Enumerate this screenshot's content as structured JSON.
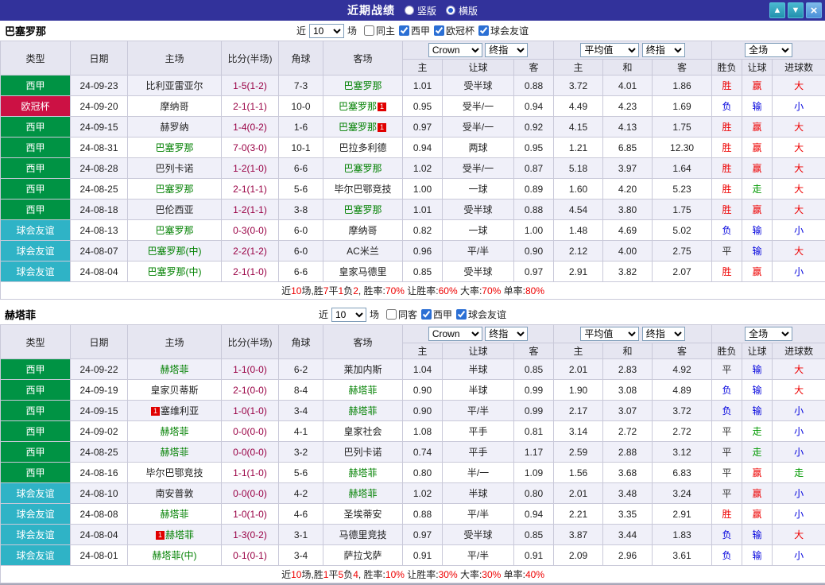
{
  "titlebar": {
    "title": "近期战绩",
    "layout_options": [
      {
        "label": "竖版",
        "selected": false
      },
      {
        "label": "横版",
        "selected": true
      }
    ],
    "buttons": {
      "up": "▲",
      "down": "▼",
      "close": "×"
    }
  },
  "filter_common": {
    "near": "近",
    "games": "场"
  },
  "table": {
    "columns": [
      "类型",
      "日期",
      "主场",
      "比分(半场)",
      "角球",
      "客场"
    ],
    "odds_group": {
      "company": "Crown",
      "stage": "终指"
    },
    "euro_group": {
      "avg": "平均值",
      "stage": "终指"
    },
    "period": "全场",
    "subcolumns": [
      "主",
      "让球",
      "客",
      "主",
      "和",
      "客",
      "胜负",
      "让球",
      "进球数"
    ]
  },
  "colors": {
    "c-titlebar": "#32329b",
    "c-liga": "#009344",
    "c-ucl": "#cc1144",
    "c-friendly": "#2fb3c6",
    "c-win": "#ee0000",
    "c-lose": "#0000dd",
    "c-draw": "#333333",
    "c-walk": "#009900",
    "c-score": "#990044",
    "c-focal": "#008000",
    "c-headbg": "#e6e6f1",
    "c-rowalt": "#f0f0f9",
    "c-border": "#c9c9d9"
  },
  "sections": [
    {
      "team": "巴塞罗那",
      "recent_count": "10",
      "checkboxes": [
        {
          "label": "同主",
          "checked": false
        },
        {
          "label": "西甲",
          "checked": true
        },
        {
          "label": "欧冠杯",
          "checked": true
        },
        {
          "label": "球会友谊",
          "checked": true
        }
      ],
      "rows": [
        {
          "type": "西甲",
          "type_cls": "liga",
          "date": "24-09-23",
          "home": "比利亚雷亚尔",
          "score": "1-5(1-2)",
          "corner": "7-3",
          "away": "巴塞罗那",
          "odds_home": "1.01",
          "handicap": "受半球",
          "odds_away": "0.88",
          "avg_home": "3.72",
          "avg_draw": "4.01",
          "avg_away": "1.86",
          "result": "胜",
          "handicap_result": "赢",
          "goals": "大"
        },
        {
          "type": "欧冠杯",
          "type_cls": "ucl",
          "date": "24-09-20",
          "home": "摩纳哥",
          "score": "2-1(1-1)",
          "corner": "10-0",
          "away": "巴塞罗那",
          "away_badge": "1",
          "away_badge_pos": "post",
          "odds_home": "0.95",
          "handicap": "受半/一",
          "odds_away": "0.94",
          "avg_home": "4.49",
          "avg_draw": "4.23",
          "avg_away": "1.69",
          "result": "负",
          "handicap_result": "输",
          "goals": "小"
        },
        {
          "type": "西甲",
          "type_cls": "liga",
          "date": "24-09-15",
          "home": "赫罗纳",
          "score": "1-4(0-2)",
          "corner": "1-6",
          "away": "巴塞罗那",
          "away_badge": "1",
          "away_badge_pos": "post",
          "odds_home": "0.97",
          "handicap": "受半/一",
          "odds_away": "0.92",
          "avg_home": "4.15",
          "avg_draw": "4.13",
          "avg_away": "1.75",
          "result": "胜",
          "handicap_result": "赢",
          "goals": "大"
        },
        {
          "type": "西甲",
          "type_cls": "liga",
          "date": "24-08-31",
          "home": "巴塞罗那",
          "score": "7-0(3-0)",
          "corner": "10-1",
          "away": "巴拉多利德",
          "odds_home": "0.94",
          "handicap": "两球",
          "odds_away": "0.95",
          "avg_home": "1.21",
          "avg_draw": "6.85",
          "avg_away": "12.30",
          "result": "胜",
          "handicap_result": "赢",
          "goals": "大"
        },
        {
          "type": "西甲",
          "type_cls": "liga",
          "date": "24-08-28",
          "home": "巴列卡诺",
          "score": "1-2(1-0)",
          "corner": "6-6",
          "away": "巴塞罗那",
          "odds_home": "1.02",
          "handicap": "受半/一",
          "odds_away": "0.87",
          "avg_home": "5.18",
          "avg_draw": "3.97",
          "avg_away": "1.64",
          "result": "胜",
          "handicap_result": "赢",
          "goals": "大"
        },
        {
          "type": "西甲",
          "type_cls": "liga",
          "date": "24-08-25",
          "home": "巴塞罗那",
          "score": "2-1(1-1)",
          "corner": "5-6",
          "away": "毕尔巴鄂竞技",
          "odds_home": "1.00",
          "handicap": "一球",
          "odds_away": "0.89",
          "avg_home": "1.60",
          "avg_draw": "4.20",
          "avg_away": "5.23",
          "result": "胜",
          "handicap_result": "走",
          "goals": "大"
        },
        {
          "type": "西甲",
          "type_cls": "liga",
          "date": "24-08-18",
          "home": "巴伦西亚",
          "score": "1-2(1-1)",
          "corner": "3-8",
          "away": "巴塞罗那",
          "odds_home": "1.01",
          "handicap": "受半球",
          "odds_away": "0.88",
          "avg_home": "4.54",
          "avg_draw": "3.80",
          "avg_away": "1.75",
          "result": "胜",
          "handicap_result": "赢",
          "goals": "大"
        },
        {
          "type": "球会友谊",
          "type_cls": "friendly",
          "date": "24-08-13",
          "home": "巴塞罗那",
          "score": "0-3(0-0)",
          "corner": "6-0",
          "away": "摩纳哥",
          "odds_home": "0.82",
          "handicap": "一球",
          "odds_away": "1.00",
          "avg_home": "1.48",
          "avg_draw": "4.69",
          "avg_away": "5.02",
          "result": "负",
          "handicap_result": "输",
          "goals": "小"
        },
        {
          "type": "球会友谊",
          "type_cls": "friendly",
          "date": "24-08-07",
          "home": "巴塞罗那(中)",
          "score": "2-2(1-2)",
          "corner": "6-0",
          "away": "AC米兰",
          "odds_home": "0.96",
          "handicap": "平/半",
          "odds_away": "0.90",
          "avg_home": "2.12",
          "avg_draw": "4.00",
          "avg_away": "2.75",
          "result": "平",
          "handicap_result": "输",
          "goals": "大"
        },
        {
          "type": "球会友谊",
          "type_cls": "friendly",
          "date": "24-08-04",
          "home": "巴塞罗那(中)",
          "score": "2-1(1-0)",
          "corner": "6-6",
          "away": "皇家马德里",
          "odds_home": "0.85",
          "handicap": "受半球",
          "odds_away": "0.97",
          "avg_home": "2.91",
          "avg_draw": "3.82",
          "avg_away": "2.07",
          "result": "胜",
          "handicap_result": "赢",
          "goals": "小"
        }
      ],
      "summary": [
        [
          "近",
          0
        ],
        [
          "10",
          1
        ],
        [
          "场,胜",
          0
        ],
        [
          "7",
          1
        ],
        [
          "平",
          0
        ],
        [
          "1",
          1
        ],
        [
          "负",
          0
        ],
        [
          "2",
          1
        ],
        [
          ", 胜率:",
          0
        ],
        [
          "70%",
          1
        ],
        [
          " 让胜率:",
          0
        ],
        [
          "60%",
          1
        ],
        [
          " 大率:",
          0
        ],
        [
          "70%",
          1
        ],
        [
          " 单率:",
          0
        ],
        [
          "80%",
          1
        ]
      ]
    },
    {
      "team": "赫塔菲",
      "recent_count": "10",
      "checkboxes": [
        {
          "label": "同客",
          "checked": false
        },
        {
          "label": "西甲",
          "checked": true
        },
        {
          "label": "球会友谊",
          "checked": true
        }
      ],
      "rows": [
        {
          "type": "西甲",
          "type_cls": "liga",
          "date": "24-09-22",
          "home": "赫塔菲",
          "score": "1-1(0-0)",
          "corner": "6-2",
          "away": "莱加内斯",
          "odds_home": "1.04",
          "handicap": "半球",
          "odds_away": "0.85",
          "avg_home": "2.01",
          "avg_draw": "2.83",
          "avg_away": "4.92",
          "result": "平",
          "handicap_result": "输",
          "goals": "大"
        },
        {
          "type": "西甲",
          "type_cls": "liga",
          "date": "24-09-19",
          "home": "皇家贝蒂斯",
          "score": "2-1(0-0)",
          "corner": "8-4",
          "away": "赫塔菲",
          "odds_home": "0.90",
          "handicap": "半球",
          "odds_away": "0.99",
          "avg_home": "1.90",
          "avg_draw": "3.08",
          "avg_away": "4.89",
          "result": "负",
          "handicap_result": "输",
          "goals": "大"
        },
        {
          "type": "西甲",
          "type_cls": "liga",
          "date": "24-09-15",
          "home": "塞维利亚",
          "home_badge": "1",
          "home_badge_pos": "pre",
          "score": "1-0(1-0)",
          "corner": "3-4",
          "away": "赫塔菲",
          "odds_home": "0.90",
          "handicap": "平/半",
          "odds_away": "0.99",
          "avg_home": "2.17",
          "avg_draw": "3.07",
          "avg_away": "3.72",
          "result": "负",
          "handicap_result": "输",
          "goals": "小"
        },
        {
          "type": "西甲",
          "type_cls": "liga",
          "date": "24-09-02",
          "home": "赫塔菲",
          "score": "0-0(0-0)",
          "corner": "4-1",
          "away": "皇家社会",
          "odds_home": "1.08",
          "handicap": "平手",
          "odds_away": "0.81",
          "avg_home": "3.14",
          "avg_draw": "2.72",
          "avg_away": "2.72",
          "result": "平",
          "handicap_result": "走",
          "goals": "小"
        },
        {
          "type": "西甲",
          "type_cls": "liga",
          "date": "24-08-25",
          "home": "赫塔菲",
          "score": "0-0(0-0)",
          "corner": "3-2",
          "away": "巴列卡诺",
          "odds_home": "0.74",
          "handicap": "平手",
          "odds_away": "1.17",
          "avg_home": "2.59",
          "avg_draw": "2.88",
          "avg_away": "3.12",
          "result": "平",
          "handicap_result": "走",
          "goals": "小"
        },
        {
          "type": "西甲",
          "type_cls": "liga",
          "date": "24-08-16",
          "home": "毕尔巴鄂竞技",
          "score": "1-1(1-0)",
          "corner": "5-6",
          "away": "赫塔菲",
          "odds_home": "0.80",
          "handicap": "半/一",
          "odds_away": "1.09",
          "avg_home": "1.56",
          "avg_draw": "3.68",
          "avg_away": "6.83",
          "result": "平",
          "handicap_result": "赢",
          "goals": "走"
        },
        {
          "type": "球会友谊",
          "type_cls": "friendly",
          "date": "24-08-10",
          "home": "南安普敦",
          "score": "0-0(0-0)",
          "corner": "4-2",
          "away": "赫塔菲",
          "odds_home": "1.02",
          "handicap": "半球",
          "odds_away": "0.80",
          "avg_home": "2.01",
          "avg_draw": "3.48",
          "avg_away": "3.24",
          "result": "平",
          "handicap_result": "赢",
          "goals": "小"
        },
        {
          "type": "球会友谊",
          "type_cls": "friendly",
          "date": "24-08-08",
          "home": "赫塔菲",
          "score": "1-0(1-0)",
          "corner": "4-6",
          "away": "圣埃蒂安",
          "odds_home": "0.88",
          "handicap": "平/半",
          "odds_away": "0.94",
          "avg_home": "2.21",
          "avg_draw": "3.35",
          "avg_away": "2.91",
          "result": "胜",
          "handicap_result": "赢",
          "goals": "小"
        },
        {
          "type": "球会友谊",
          "type_cls": "friendly",
          "date": "24-08-04",
          "home": "赫塔菲",
          "home_badge": "1",
          "home_badge_pos": "pre",
          "score": "1-3(0-2)",
          "corner": "3-1",
          "away": "马德里竞技",
          "odds_home": "0.97",
          "handicap": "受半球",
          "odds_away": "0.85",
          "avg_home": "3.87",
          "avg_draw": "3.44",
          "avg_away": "1.83",
          "result": "负",
          "handicap_result": "输",
          "goals": "大"
        },
        {
          "type": "球会友谊",
          "type_cls": "friendly",
          "date": "24-08-01",
          "home": "赫塔菲(中)",
          "score": "0-1(0-1)",
          "corner": "3-4",
          "away": "萨拉戈萨",
          "odds_home": "0.91",
          "handicap": "平/半",
          "odds_away": "0.91",
          "avg_home": "2.09",
          "avg_draw": "2.96",
          "avg_away": "3.61",
          "result": "负",
          "handicap_result": "输",
          "goals": "小"
        }
      ],
      "summary": [
        [
          "近",
          0
        ],
        [
          "10",
          1
        ],
        [
          "场,胜",
          0
        ],
        [
          "1",
          1
        ],
        [
          "平",
          0
        ],
        [
          "5",
          1
        ],
        [
          "负",
          0
        ],
        [
          "4",
          1
        ],
        [
          ", 胜率:",
          0
        ],
        [
          "10%",
          1
        ],
        [
          " 让胜率:",
          0
        ],
        [
          "30%",
          1
        ],
        [
          " 大率:",
          0
        ],
        [
          "30%",
          1
        ],
        [
          " 单率:",
          0
        ],
        [
          "40%",
          1
        ]
      ]
    }
  ]
}
